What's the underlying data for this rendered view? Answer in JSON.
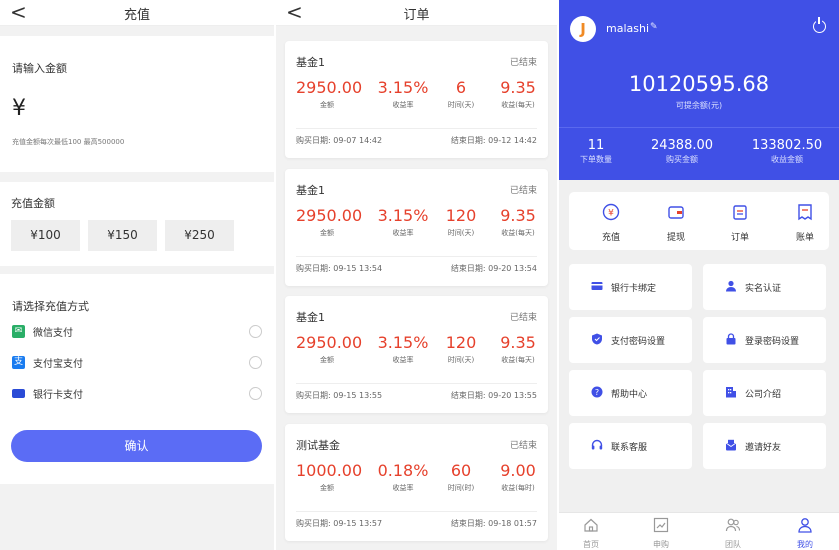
{
  "recharge": {
    "nav_back": "<",
    "title": "充值",
    "amount_label": "请输入金额",
    "currency_symbol": "¥",
    "hint": "充值金额每次最低100  最高500000",
    "quick_label": "充值金额",
    "chips": [
      "¥100",
      "¥150",
      "¥250"
    ],
    "method_label": "请选择充值方式",
    "methods": [
      {
        "name": "微信支付",
        "icon": "wechat-icon",
        "color": "#2aae67"
      },
      {
        "name": "支付宝支付",
        "icon": "alipay-icon",
        "color": "#1a7cf0"
      },
      {
        "name": "银行卡支付",
        "icon": "bank-card-icon",
        "color": "#2a4bd6"
      }
    ],
    "confirm": "确认"
  },
  "orders": {
    "nav_back": "<",
    "title": "订单",
    "items": [
      {
        "name": "基金1",
        "status": "已结束",
        "amount": "2950.00",
        "rate": "3.15%",
        "duration": "6",
        "income": "9.35",
        "amount_lbl": "金额",
        "rate_lbl": "收益率",
        "duration_lbl": "时间(天)",
        "income_lbl": "收益(每天)",
        "buy": "购买日期: 09-07 14:42",
        "end": "结束日期: 09-12 14:42"
      },
      {
        "name": "基金1",
        "status": "已结束",
        "amount": "2950.00",
        "rate": "3.15%",
        "duration": "120",
        "income": "9.35",
        "amount_lbl": "金额",
        "rate_lbl": "收益率",
        "duration_lbl": "时间(天)",
        "income_lbl": "收益(每天)",
        "buy": "购买日期: 09-15 13:54",
        "end": "结束日期: 09-20 13:54"
      },
      {
        "name": "基金1",
        "status": "已结束",
        "amount": "2950.00",
        "rate": "3.15%",
        "duration": "120",
        "income": "9.35",
        "amount_lbl": "金额",
        "rate_lbl": "收益率",
        "duration_lbl": "时间(天)",
        "income_lbl": "收益(每天)",
        "buy": "购买日期: 09-15 13:55",
        "end": "结束日期: 09-20 13:55"
      },
      {
        "name": "测试基金",
        "status": "已结束",
        "amount": "1000.00",
        "rate": "0.18%",
        "duration": "60",
        "income": "9.00",
        "amount_lbl": "金额",
        "rate_lbl": "收益率",
        "duration_lbl": "时间(时)",
        "income_lbl": "收益(每时)",
        "buy": "购买日期: 09-15 13:57",
        "end": "结束日期: 09-18 01:57"
      }
    ]
  },
  "profile": {
    "avatar_letter": "J",
    "username": "malashi",
    "edit_glyph": "✎",
    "balance": "10120595.68",
    "balance_label": "可提余额(元)",
    "stats": [
      {
        "value": "11",
        "label": "下单数量"
      },
      {
        "value": "24388.00",
        "label": "购买金额"
      },
      {
        "value": "133802.50",
        "label": "收益金额"
      }
    ],
    "quick": [
      {
        "label": "充值",
        "icon": "yen-circle-icon"
      },
      {
        "label": "提现",
        "icon": "wallet-icon"
      },
      {
        "label": "订单",
        "icon": "clipboard-icon"
      },
      {
        "label": "账单",
        "icon": "bill-icon"
      }
    ],
    "tiles": [
      {
        "label": "银行卡绑定",
        "icon": "bank-card-icon"
      },
      {
        "label": "实名认证",
        "icon": "user-icon"
      },
      {
        "label": "支付密码设置",
        "icon": "shield-icon"
      },
      {
        "label": "登录密码设置",
        "icon": "lock-icon"
      },
      {
        "label": "帮助中心",
        "icon": "help-icon"
      },
      {
        "label": "公司介绍",
        "icon": "building-icon"
      },
      {
        "label": "联系客服",
        "icon": "headset-icon"
      },
      {
        "label": "邀请好友",
        "icon": "invite-icon"
      }
    ],
    "tabs": [
      {
        "label": "首页",
        "icon": "home-icon"
      },
      {
        "label": "申购",
        "icon": "chart-icon"
      },
      {
        "label": "团队",
        "icon": "team-icon"
      },
      {
        "label": "我的",
        "icon": "profile-icon"
      }
    ],
    "colors": {
      "primary": "#4050e6",
      "accent_red": "#e6412c"
    }
  }
}
